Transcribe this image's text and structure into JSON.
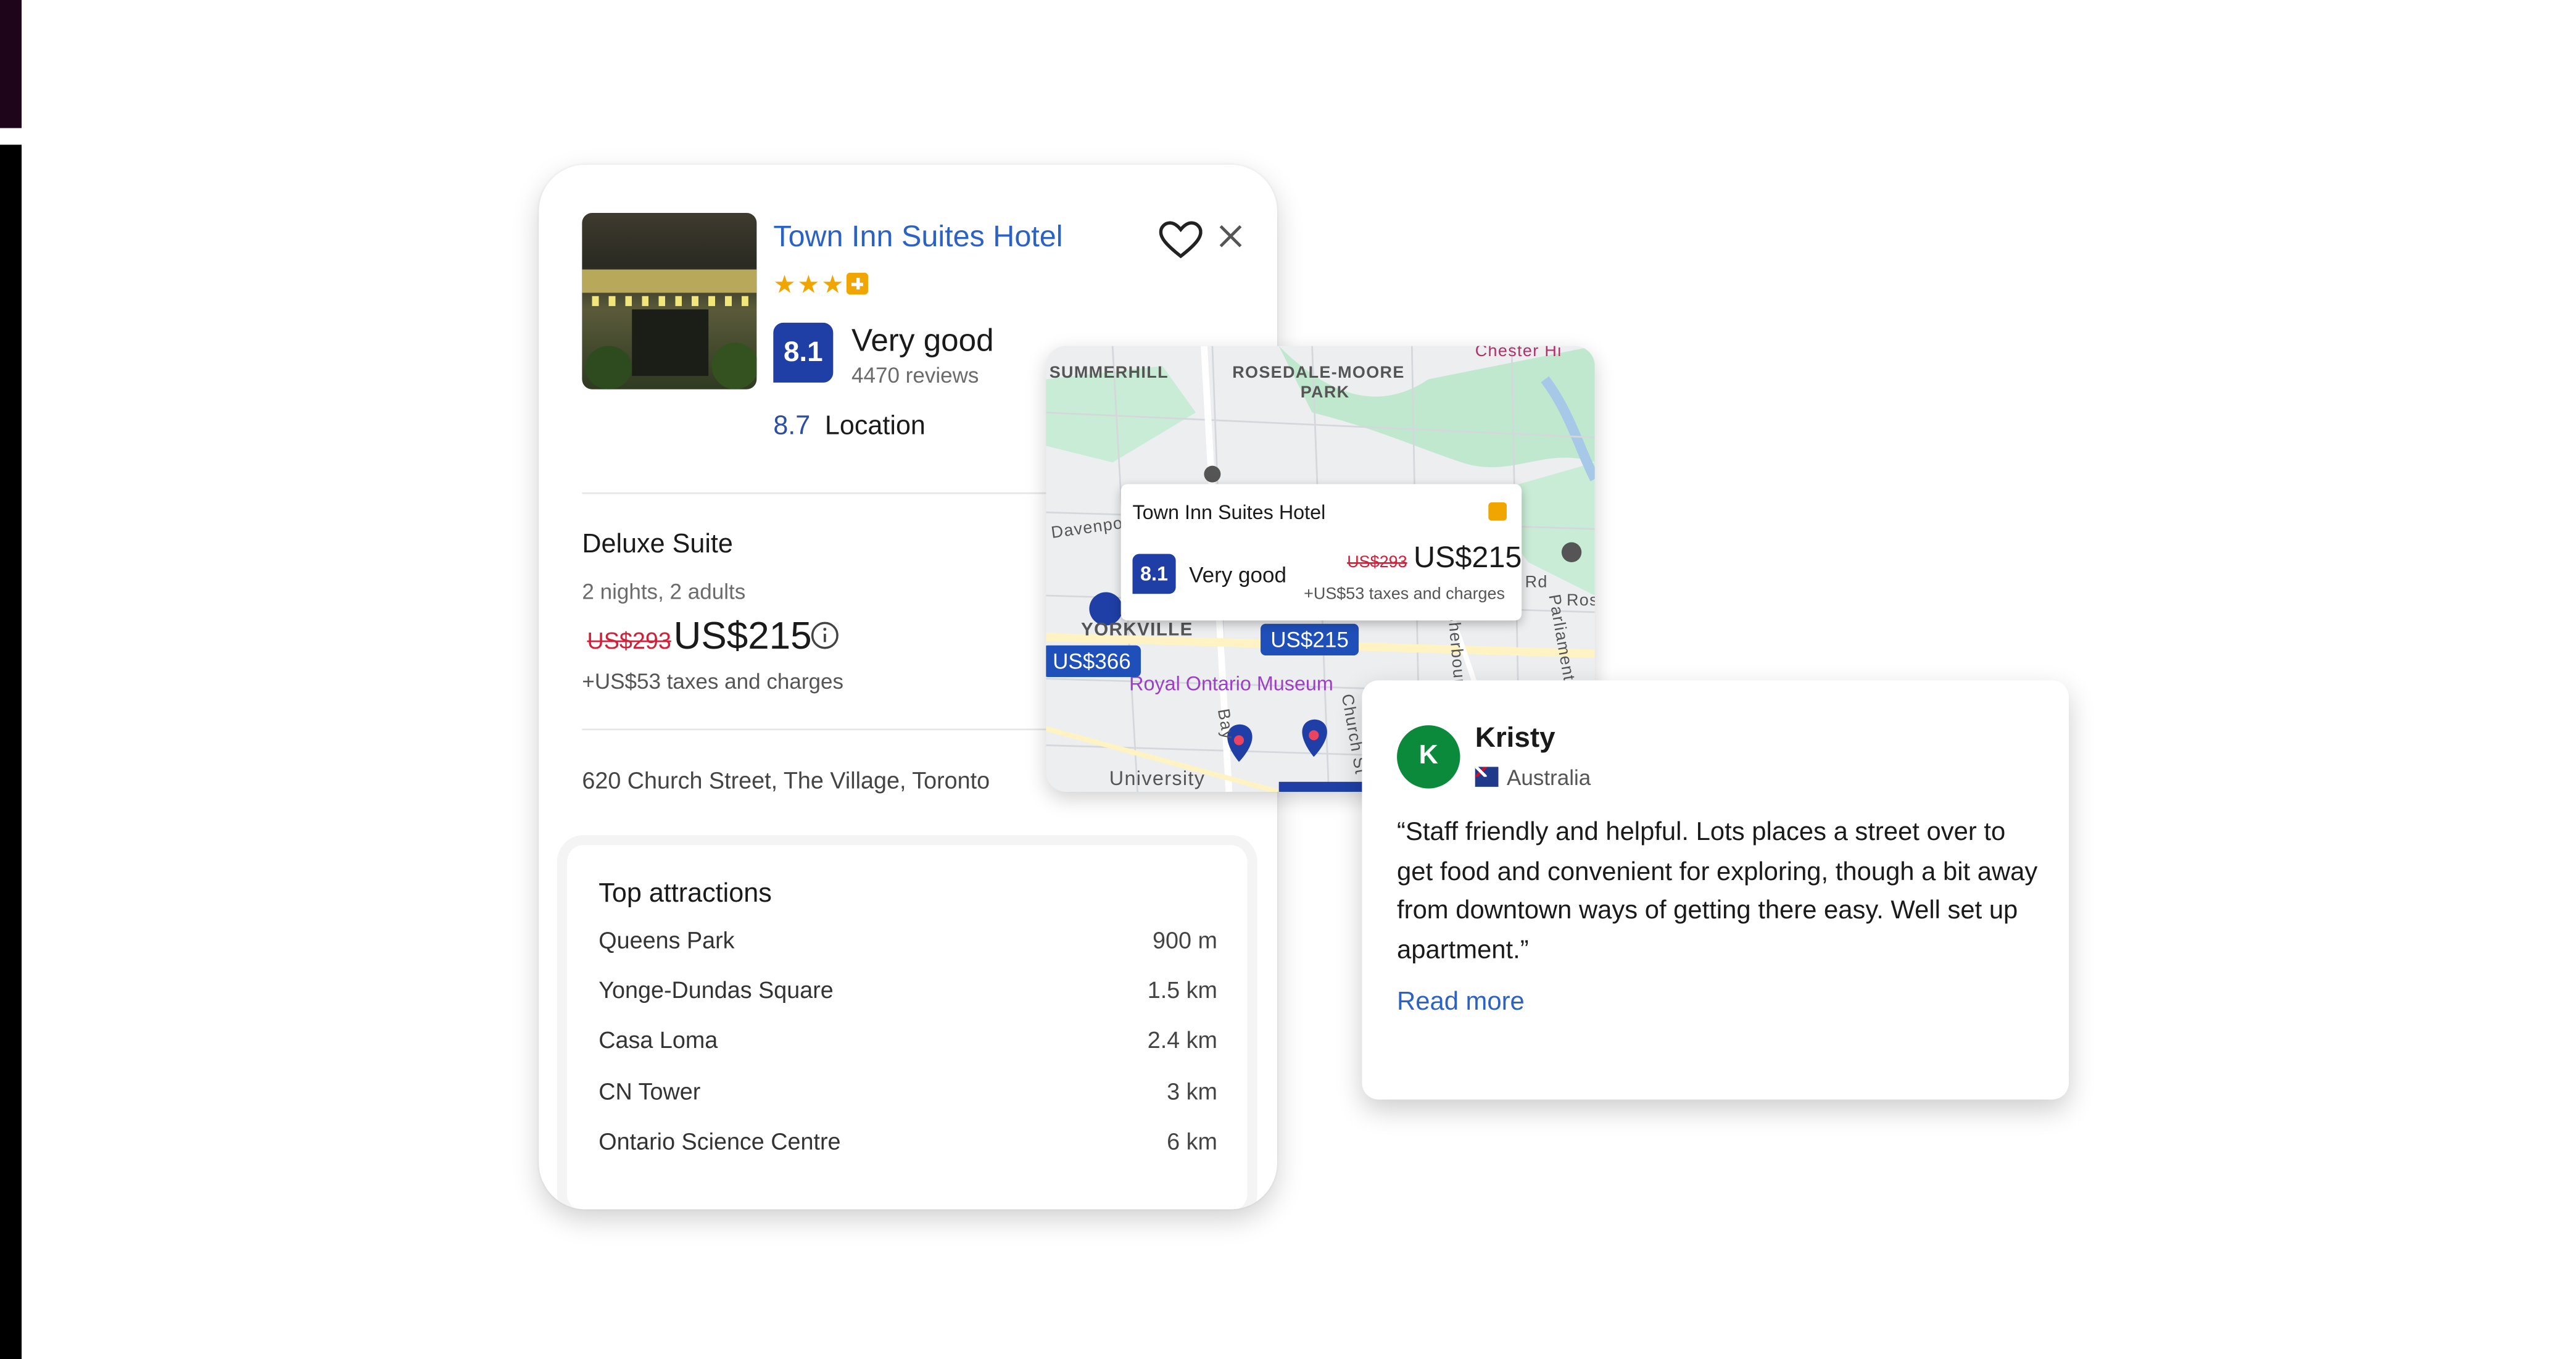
{
  "hotel": {
    "name": "Town Inn Suites Hotel",
    "stars": "★★★",
    "score": "8.1",
    "score_label": "Very good",
    "reviews": "4470 reviews",
    "location_score": "8.7",
    "location_label": "Location"
  },
  "offer": {
    "room": "Deluxe Suite",
    "meta": "2 nights, 2 adults",
    "old_price": "US$293",
    "price": "US$215",
    "taxes": "+US$53 taxes and charges"
  },
  "address": "620 Church Street, The Village, Toronto",
  "attractions": {
    "title": "Top attractions",
    "items": [
      {
        "name": "Queens Park",
        "distance": "900 m"
      },
      {
        "name": "Yonge-Dundas Square",
        "distance": "1.5 km"
      },
      {
        "name": "Casa Loma",
        "distance": "2.4 km"
      },
      {
        "name": "CN Tower",
        "distance": "3 km"
      },
      {
        "name": "Ontario Science Centre",
        "distance": "6 km"
      }
    ]
  },
  "map": {
    "labels": {
      "summerhill": "SUMMERHILL",
      "rosedale": "ROSEDALE-MOORE",
      "park": "PARK",
      "chester": "Chester Hi",
      "davenport": "Davenport",
      "yorkville": "YORKVILLE",
      "university": "University",
      "rose": "Ros",
      "parliament": "Parliament",
      "sherbourne": "Sherbourne",
      "church": "Church St",
      "bay": "Bay",
      "rd": "Rd"
    },
    "poi": "Royal Ontario Museum",
    "pins": {
      "hotel": "US$215",
      "other": "US$366"
    },
    "popup": {
      "name": "Town Inn Suites Hotel",
      "score": "8.1",
      "label": "Very good",
      "old_price": "US$293",
      "price": "US$215",
      "taxes": "+US$53 taxes and charges"
    }
  },
  "review": {
    "initial": "K",
    "name": "Kristy",
    "country": "Australia",
    "text": "“Staff friendly and helpful. Lots places a street over to get food and convenient for exploring, though a bit away from downtown ways of getting there easy. Well set up apartment.”",
    "read_more": "Read more"
  },
  "colors": {
    "link": "#2c62c4",
    "badge": "#1f3fa6",
    "strike": "#d0213a",
    "star": "#f0a500",
    "avatar": "#0c8a3c"
  }
}
